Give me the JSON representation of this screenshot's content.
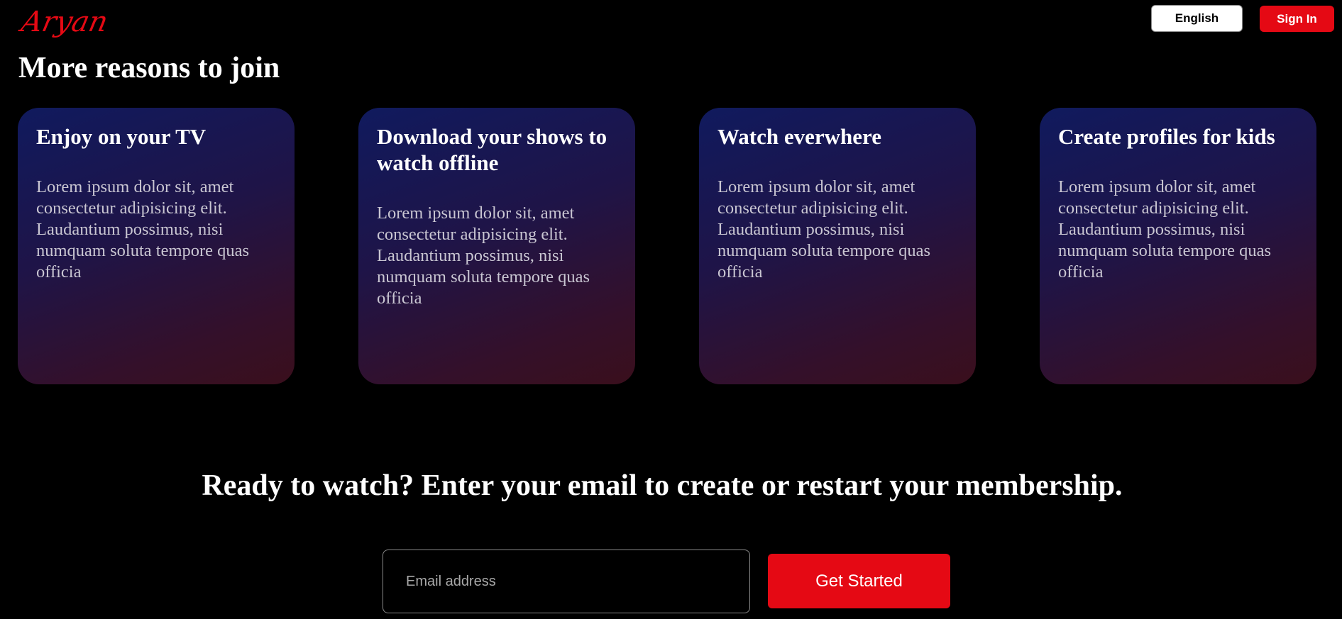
{
  "header": {
    "logo_text": "Aryan",
    "language_label": "English",
    "signin_label": "Sign In"
  },
  "reasons": {
    "title": "More reasons to join",
    "cards": [
      {
        "title": "Enjoy on your TV",
        "text": "Lorem ipsum dolor sit, amet consectetur adipisicing elit. Laudantium possimus, nisi numquam soluta tempore quas officia"
      },
      {
        "title": "Download your shows to watch offline",
        "text": "Lorem ipsum dolor sit, amet consectetur adipisicing elit. Laudantium possimus, nisi numquam soluta tempore quas officia"
      },
      {
        "title": "Watch everwhere",
        "text": "Lorem ipsum dolor sit, amet consectetur adipisicing elit. Laudantium possimus, nisi numquam soluta tempore quas officia"
      },
      {
        "title": "Create profiles for kids",
        "text": "Lorem ipsum dolor sit, amet consectetur adipisicing elit. Laudantium possimus, nisi numquam soluta tempore quas officia"
      }
    ]
  },
  "cta": {
    "title": "Ready to watch? Enter your email to create or restart your membership.",
    "email_placeholder": "Email address",
    "email_value": "",
    "button_label": "Get Started"
  },
  "colors": {
    "brand_red": "#e50914",
    "background": "#000000"
  }
}
